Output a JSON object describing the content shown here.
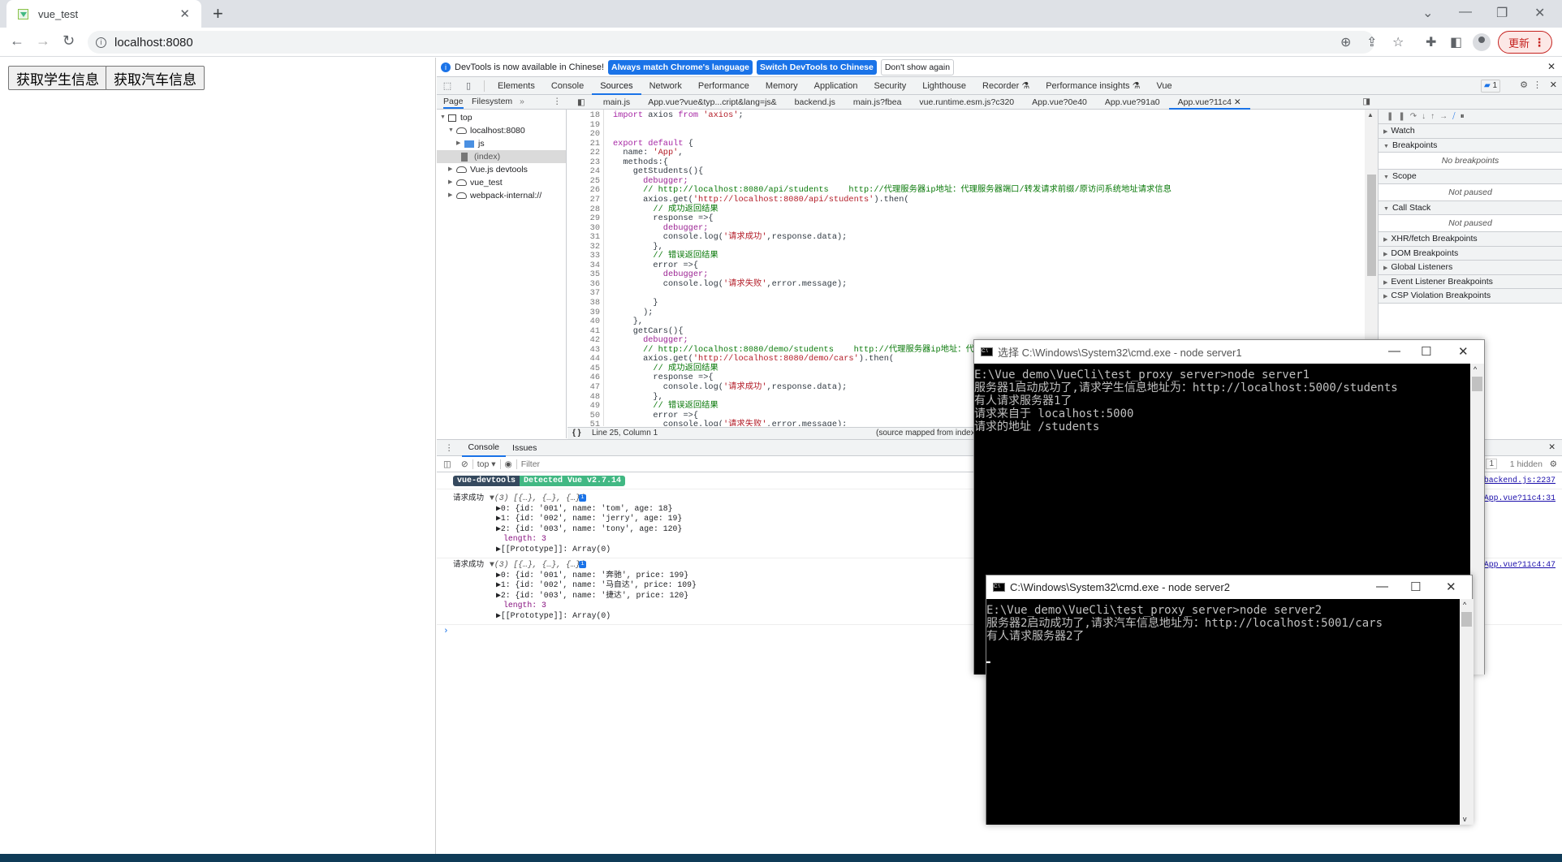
{
  "browser": {
    "tab_title": "vue_test",
    "url": "localhost:8080",
    "update_label": "更新",
    "icons": [
      "back-icon",
      "forward-icon",
      "reload-icon",
      "info-icon",
      "zoom-icon",
      "share-icon",
      "star-icon",
      "extensions-icon",
      "sidepanel-icon",
      "profile-icon",
      "menu-icon"
    ]
  },
  "page": {
    "buttons": [
      "获取学生信息",
      "获取汽车信息"
    ]
  },
  "devtools": {
    "banner": {
      "text": "DevTools is now available in Chinese!",
      "btn_match": "Always match Chrome's language",
      "btn_switch": "Switch DevTools to Chinese",
      "btn_dismiss": "Don't show again"
    },
    "main_tabs": [
      "Elements",
      "Console",
      "Sources",
      "Network",
      "Performance",
      "Memory",
      "Application",
      "Security",
      "Lighthouse",
      "Recorder ⚗",
      "Performance insights ⚗",
      "Vue"
    ],
    "active_tab": "Sources",
    "issues_count": "1",
    "nav_tabs": [
      "Page",
      "Filesystem",
      "»"
    ],
    "file_tabs": [
      "main.js",
      "App.vue?vue&typ...cript&lang=js&",
      "backend.js",
      "main.js?fbea",
      "vue.runtime.esm.js?c320",
      "App.vue?0e40",
      "App.vue?91a0",
      "App.vue?11c4"
    ],
    "active_file": "App.vue?11c4",
    "tree": [
      {
        "label": "top",
        "depth": 0,
        "type": "frame",
        "expanded": true
      },
      {
        "label": "localhost:8080",
        "depth": 1,
        "type": "cloud",
        "expanded": true
      },
      {
        "label": "js",
        "depth": 2,
        "type": "folder",
        "expanded": false
      },
      {
        "label": "(index)",
        "depth": 2,
        "type": "file",
        "selected": true
      },
      {
        "label": "Vue.js devtools",
        "depth": 1,
        "type": "cloud",
        "expanded": false
      },
      {
        "label": "vue_test",
        "depth": 1,
        "type": "cloud",
        "expanded": false
      },
      {
        "label": "webpack-internal://",
        "depth": 1,
        "type": "cloud",
        "expanded": false
      }
    ],
    "code_lines": [
      {
        "n": "18",
        "t": "import axios from 'axios';"
      },
      {
        "n": "19",
        "t": ""
      },
      {
        "n": "20",
        "t": ""
      },
      {
        "n": "21",
        "t": "export default {"
      },
      {
        "n": "22",
        "t": "  name: 'App',"
      },
      {
        "n": "23",
        "t": "  methods:{"
      },
      {
        "n": "24",
        "t": "    getStudents(){"
      },
      {
        "n": "25",
        "t": "      debugger;"
      },
      {
        "n": "26",
        "t": "      // http://localhost:8080/api/students    http://代理服务器ip地址：代理服务器端口/转发请求前缀/原访问系统地址请求信息"
      },
      {
        "n": "27",
        "t": "      axios.get('http://localhost:8080/api/students').then("
      },
      {
        "n": "28",
        "t": "        // 成功返回结果"
      },
      {
        "n": "29",
        "t": "        response =>{"
      },
      {
        "n": "30",
        "t": "          debugger;"
      },
      {
        "n": "31",
        "t": "          console.log('请求成功',response.data);"
      },
      {
        "n": "32",
        "t": "        },"
      },
      {
        "n": "33",
        "t": "        // 错误返回结果"
      },
      {
        "n": "34",
        "t": "        error =>{"
      },
      {
        "n": "35",
        "t": "          debugger;"
      },
      {
        "n": "36",
        "t": "          console.log('请求失败',error.message);"
      },
      {
        "n": "37",
        "t": ""
      },
      {
        "n": "38",
        "t": "        }"
      },
      {
        "n": "39",
        "t": "      );"
      },
      {
        "n": "40",
        "t": "    },"
      },
      {
        "n": "41",
        "t": "    getCars(){"
      },
      {
        "n": "42",
        "t": "      debugger;"
      },
      {
        "n": "43",
        "t": "      // http://localhost:8080/demo/students    http://代理服务器ip地址：代理服务器端口"
      },
      {
        "n": "44",
        "t": "      axios.get('http://localhost:8080/demo/cars').then("
      },
      {
        "n": "45",
        "t": "        // 成功返回结果"
      },
      {
        "n": "46",
        "t": "        response =>{"
      },
      {
        "n": "47",
        "t": "          console.log('请求成功',response.data);"
      },
      {
        "n": "48",
        "t": "        },"
      },
      {
        "n": "49",
        "t": "        // 错误返回结果"
      },
      {
        "n": "50",
        "t": "        error =>{"
      },
      {
        "n": "51",
        "t": "          console.log('请求失败',error.message);"
      }
    ],
    "status": {
      "position": "Line 25, Column 1",
      "source_mapped": "(source mapped from index."
    },
    "debugger_sections": [
      {
        "title": "Watch",
        "expanded": false
      },
      {
        "title": "Breakpoints",
        "expanded": true,
        "body": "No breakpoints"
      },
      {
        "title": "Scope",
        "expanded": true,
        "body": "Not paused"
      },
      {
        "title": "Call Stack",
        "expanded": true,
        "body": "Not paused"
      },
      {
        "title": "XHR/fetch Breakpoints",
        "expanded": false
      },
      {
        "title": "DOM Breakpoints",
        "expanded": false
      },
      {
        "title": "Global Listeners",
        "expanded": false
      },
      {
        "title": "Event Listener Breakpoints",
        "expanded": false
      },
      {
        "title": "CSP Violation Breakpoints",
        "expanded": false
      }
    ],
    "drawer_tabs": [
      "Console",
      "Issues"
    ],
    "console": {
      "context": "top ▾",
      "filter_placeholder": "Filter",
      "issues_badge": "1",
      "hidden": "1 hidden",
      "vue_badge_left": "vue-devtools",
      "vue_badge_right": "Detected Vue v2.7.14",
      "vue_link": "backend.js:2237",
      "logs": [
        {
          "label": "请求成功",
          "summary": "▼(3) [{…}, {…}, {…}]",
          "link": "App.vue?11c4:31",
          "items": [
            "▶0: {id: '001', name: 'tom', age: 18}",
            "▶1: {id: '002', name: 'jerry', age: 19}",
            "▶2: {id: '003', name: 'tony', age: 120}"
          ],
          "length": "length: 3",
          "proto": "▶[[Prototype]]: Array(0)"
        },
        {
          "label": "请求成功",
          "summary": "▼(3) [{…}, {…}, {…}]",
          "link": "App.vue?11c4:47",
          "items": [
            "▶0: {id: '001', name: '奔驰', price: 199}",
            "▶1: {id: '002', name: '马自达', price: 109}",
            "▶2: {id: '003', name: '捷达', price: 120}"
          ],
          "length": "length: 3",
          "proto": "▶[[Prototype]]: Array(0)"
        }
      ],
      "prompt": "›"
    }
  },
  "cmd1": {
    "title": "选择 C:\\Windows\\System32\\cmd.exe - node  server1",
    "lines": [
      "E:\\Vue_demo\\VueCli\\test_proxy_server>node server1",
      "服务器1启动成功了,请求学生信息地址为：http://localhost:5000/students",
      "有人请求服务器1了",
      "请求来自于 localhost:5000",
      "请求的地址 /students"
    ]
  },
  "cmd2": {
    "title": "C:\\Windows\\System32\\cmd.exe - node  server2",
    "lines": [
      "E:\\Vue_demo\\VueCli\\test_proxy_server>node server2",
      "服务器2启动成功了,请求汽车信息地址为：http://localhost:5001/cars",
      "有人请求服务器2了",
      "",
      "▬"
    ]
  }
}
